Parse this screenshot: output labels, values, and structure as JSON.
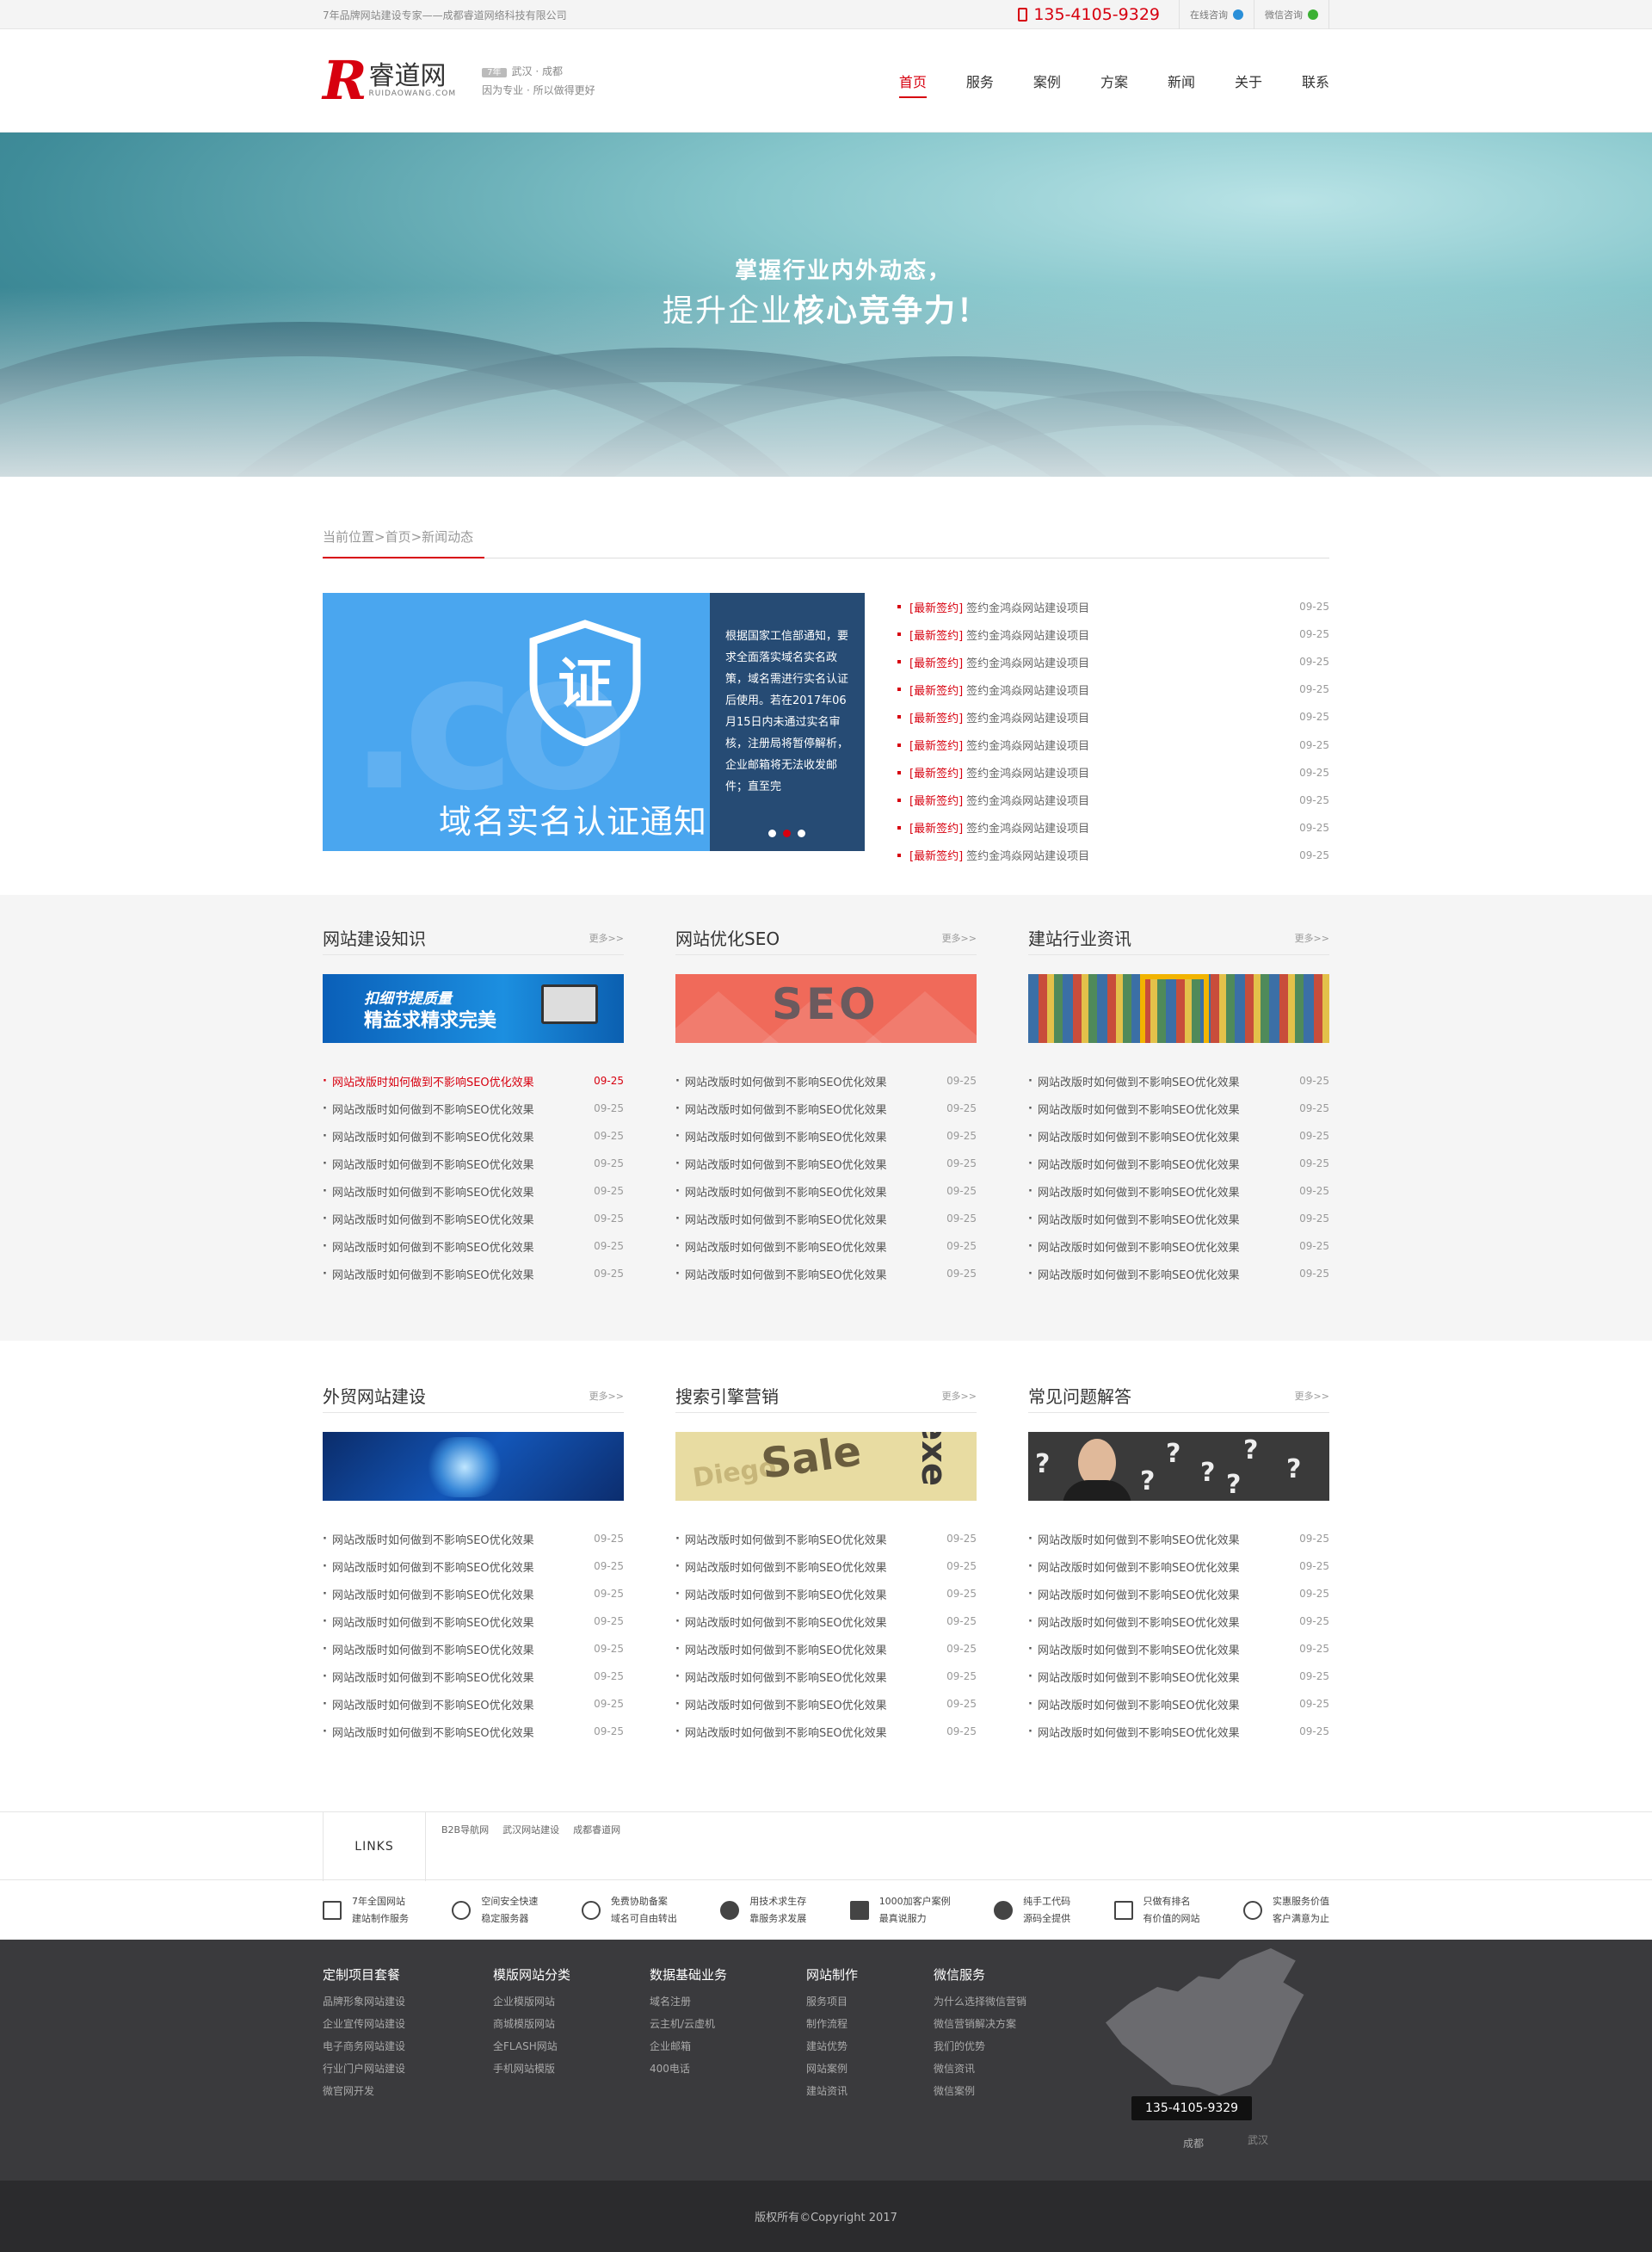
{
  "topbar": {
    "slogan": "7年品牌网站建设专家——成都睿道网络科技有限公司",
    "phone": "135-4105-9329",
    "online_consult": "在线咨询",
    "wechat_consult": "微信咨询"
  },
  "header": {
    "logo_mark": "R",
    "logo_cn": "睿道网",
    "logo_en": "RUIDAOWANG.COM",
    "badge": "7年",
    "cities": "武汉 · 成都",
    "tagline": "因为专业 · 所以做得更好",
    "nav": [
      "首页",
      "服务",
      "案例",
      "方案",
      "新闻",
      "关于",
      "联系"
    ]
  },
  "banner": {
    "line1": "掌握行业内外动态，",
    "line2_a": "提升企业",
    "line2_b": "核心竞争力！"
  },
  "breadcrumb": "当前位置>首页>新闻动态",
  "slide": {
    "shield_text": "证",
    "caption": "域名实名认证通知",
    "panel": "根据国家工信部通知，要求全面落实域名实名政策，域名需进行实名认证后使用。若在2017年06月15日内未通过实名审核，注册局将暂停解析，企业邮箱将无法收发邮件；直至完",
    "dots": 3,
    "active_dot": 1
  },
  "top_news": [
    {
      "tag": "[最新签约]",
      "title": "签约金鸿焱网站建设项目",
      "date": "09-25"
    },
    {
      "tag": "[最新签约]",
      "title": "签约金鸿焱网站建设项目",
      "date": "09-25"
    },
    {
      "tag": "[最新签约]",
      "title": "签约金鸿焱网站建设项目",
      "date": "09-25"
    },
    {
      "tag": "[最新签约]",
      "title": "签约金鸿焱网站建设项目",
      "date": "09-25"
    },
    {
      "tag": "[最新签约]",
      "title": "签约金鸿焱网站建设项目",
      "date": "09-25"
    },
    {
      "tag": "[最新签约]",
      "title": "签约金鸿焱网站建设项目",
      "date": "09-25"
    },
    {
      "tag": "[最新签约]",
      "title": "签约金鸿焱网站建设项目",
      "date": "09-25"
    },
    {
      "tag": "[最新签约]",
      "title": "签约金鸿焱网站建设项目",
      "date": "09-25"
    },
    {
      "tag": "[最新签约]",
      "title": "签约金鸿焱网站建设项目",
      "date": "09-25"
    },
    {
      "tag": "[最新签约]",
      "title": "签约金鸿焱网站建设项目",
      "date": "09-25"
    }
  ],
  "more_label": "更多>>",
  "article_title": "网站改版时如何做到不影响SEO优化效果",
  "article_date": "09-25",
  "section1": [
    {
      "title": "网站建设知识",
      "img": {
        "line1": "扣细节提质量",
        "line2": "精益求精求完美"
      }
    },
    {
      "title": "网站优化SEO",
      "img": {
        "word": "SEO"
      }
    },
    {
      "title": "建站行业资讯"
    }
  ],
  "section2": [
    {
      "title": "外贸网站建设"
    },
    {
      "title": "搜索引擎营销",
      "img": {
        "w1": "Sale",
        "w2": "Diego",
        "w3": "exe"
      }
    },
    {
      "title": "常见问题解答",
      "img": {
        "mark": "?"
      }
    }
  ],
  "links": {
    "label": "LINKS",
    "items": [
      "B2B导航网",
      "武汉网站建设",
      "成都睿道网"
    ]
  },
  "features": [
    {
      "icon": "diamond-icon",
      "l1": "7年全国网站",
      "l2": "建站制作服务"
    },
    {
      "icon": "shield-check-icon",
      "l1": "空间安全快速",
      "l2": "稳定服务器"
    },
    {
      "icon": "no-entry-icon",
      "l1": "免费协助备案",
      "l2": "域名可自由转出"
    },
    {
      "icon": "thumbs-up-icon",
      "l1": "用技术求生存",
      "l2": "靠服务求发展"
    },
    {
      "icon": "books-icon",
      "l1": "1000加客户案例",
      "l2": "最真说服力"
    },
    {
      "icon": "user-icon",
      "l1": "纯手工代码",
      "l2": "源码全提供"
    },
    {
      "icon": "monitor-icon",
      "l1": "只做有排名",
      "l2": "有价值的网站"
    },
    {
      "icon": "smile-icon",
      "l1": "实惠服务价值",
      "l2": "客户满意为止"
    }
  ],
  "footer": {
    "columns": [
      {
        "title": "定制项目套餐",
        "items": [
          "品牌形象网站建设",
          "企业宣传网站建设",
          "电子商务网站建设",
          "行业门户网站建设",
          "微官网开发"
        ]
      },
      {
        "title": "模版网站分类",
        "items": [
          "企业模版网站",
          "商城模版网站",
          "全FLASH网站",
          "手机网站模版"
        ]
      },
      {
        "title": "数据基础业务",
        "items": [
          "域名注册",
          "云主机/云虚机",
          "企业邮箱",
          "400电话"
        ]
      },
      {
        "title": "网站制作",
        "items": [
          "服务项目",
          "制作流程",
          "建站优势",
          "网站案例",
          "建站资讯"
        ]
      },
      {
        "title": "微信服务",
        "items": [
          "为什么选择微信营销",
          "微信营销解决方案",
          "我们的优势",
          "微信资讯",
          "微信案例"
        ]
      }
    ],
    "map_phone": "135-4105-9329",
    "city1": "成都",
    "city2": "武汉",
    "copyright": "版权所有©Copyright 2017"
  },
  "colors": {
    "brand": "#d7000f",
    "footer_bg": "#3a3a3d",
    "grey_bg": "#f5f5f5"
  }
}
